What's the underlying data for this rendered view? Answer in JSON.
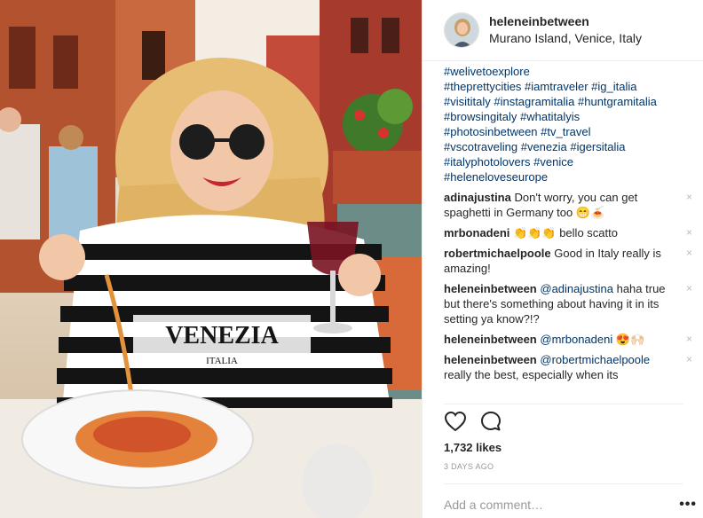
{
  "post": {
    "username": "heleneinbetween",
    "location": "Murano Island, Venice, Italy"
  },
  "caption": {
    "lines": [
      "#welivetoexplore",
      "#theprettycities #iamtraveler #ig_italia",
      "#visititaly #instagramitalia #huntgramitalia",
      "#browsingitaly #whatitalyis",
      "#photosinbetween #tv_travel",
      "#vscotraveling #venezia #igersitalia",
      "#italyphotolovers #venice",
      "#heleneloveseurope"
    ]
  },
  "comments": [
    {
      "user": "adinajustina",
      "text": "Don't worry, you can get spaghetti in Germany too 😁🍝",
      "mention": ""
    },
    {
      "user": "mrbonadeni",
      "text": "👏👏👏 bello scatto",
      "mention": ""
    },
    {
      "user": "robertmichaelpoole",
      "text": "Good in Italy really is amazing!",
      "mention": ""
    },
    {
      "user": "heleneinbetween",
      "mention": "@adinajustina",
      "text": "haha true but there's something about having it in its setting ya know?!?"
    },
    {
      "user": "heleneinbetween",
      "mention": "@mrbonadeni",
      "text": "😍🙌🏻"
    },
    {
      "user": "heleneinbetween",
      "mention": "@robertmichaelpoole",
      "text": "really the best, especially when its"
    }
  ],
  "delete_glyph": "×",
  "likes": "1,732 likes",
  "timestamp": "3 DAYS AGO",
  "add_comment_placeholder": "Add a comment…",
  "more_glyph": "•••",
  "icons": {
    "like": "heart-icon",
    "comment": "speech-bubble-icon",
    "more": "more-options-icon"
  },
  "colors": {
    "hashtag": "#003569",
    "text": "#262626",
    "muted": "#999999",
    "border": "#efefef"
  }
}
